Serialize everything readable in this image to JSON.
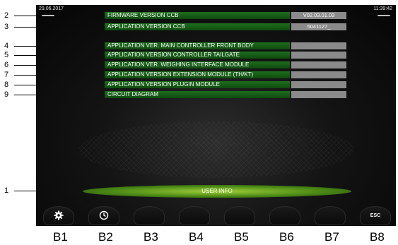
{
  "status": {
    "date": "29.06.2017",
    "time": "11:39:42"
  },
  "rows": [
    {
      "label": "FIRMWARE VERSION CCB",
      "value": "V02.03.01.03"
    },
    {
      "label": "APPLICATION VERSION CCB",
      "value": "5041127_"
    },
    {
      "label": "APPLICATION VER. MAIN CONTROLLER FRONT BODY",
      "value": ""
    },
    {
      "label": "APPLICATION VERSION CONTROLLER TAILGATE",
      "value": ""
    },
    {
      "label": "APPLICATION VER. WEIGHING INTERFACE MODULE",
      "value": ""
    },
    {
      "label": "APPLICATION VERSION EXTENSION MODULE (TH/KT)",
      "value": ""
    },
    {
      "label": "APPLICATION VERSION PLUGIN MODULE",
      "value": ""
    },
    {
      "label": "CIRCUIT DIAGRAM",
      "value": ""
    }
  ],
  "user_info_label": "USER INFO",
  "buttons": {
    "b1_icon": "gear-icon",
    "b2_icon": "clock-icon",
    "b8_label": "ESC"
  },
  "callouts": [
    "2",
    "3",
    "4",
    "5",
    "6",
    "7",
    "8",
    "9",
    "1"
  ],
  "button_labels": [
    "B1",
    "B2",
    "B3",
    "B4",
    "B5",
    "B6",
    "B7",
    "B8"
  ]
}
